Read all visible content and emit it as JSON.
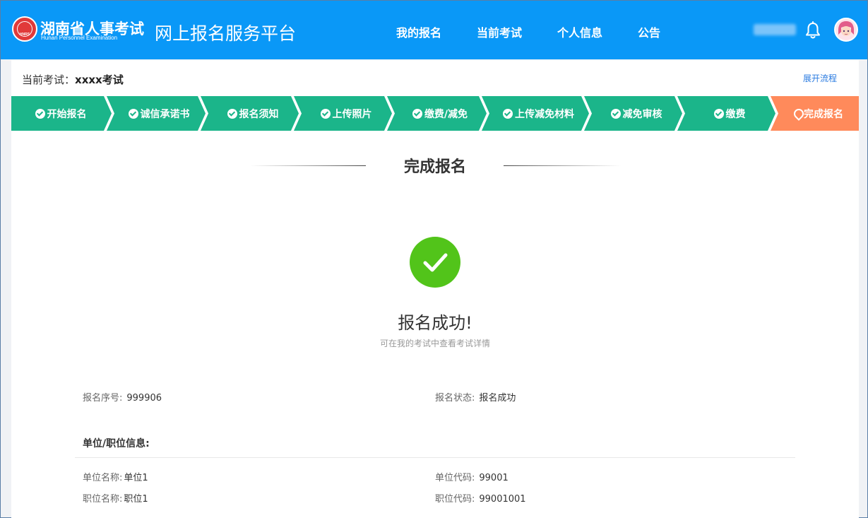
{
  "header": {
    "logo_cn": "湖南省人事考试",
    "logo_en": "Hunan Personnel Examination",
    "logo_badge": "HNRS",
    "platform_title": "网上报名服务平台",
    "nav": [
      "我的报名",
      "当前考试",
      "个人信息",
      "公告"
    ],
    "icons": {
      "bell": "bell-icon",
      "avatar": "avatar"
    }
  },
  "exam": {
    "label": "当前考试：",
    "name": "xxxx考试",
    "expand_link": "展开流程"
  },
  "steps": [
    {
      "label": "开始报名",
      "state": "done"
    },
    {
      "label": "诚信承诺书",
      "state": "done"
    },
    {
      "label": "报名须知",
      "state": "done"
    },
    {
      "label": "上传照片",
      "state": "done"
    },
    {
      "label": "缴费/减免",
      "state": "done"
    },
    {
      "label": "上传减免材料",
      "state": "done"
    },
    {
      "label": "减免审核",
      "state": "done"
    },
    {
      "label": "缴费",
      "state": "done"
    },
    {
      "label": "完成报名",
      "state": "current"
    }
  ],
  "colors": {
    "header_bg": "#0a98f7",
    "step_done": "#1bb58a",
    "step_current": "#ff8a5b",
    "success": "#52c41a"
  },
  "result": {
    "section_title": "完成报名",
    "status_title": "报名成功!",
    "status_sub": "可在我的考试中查看考试详情"
  },
  "details": {
    "serial_label": "报名序号:",
    "serial_value": "999906",
    "status_label": "报名状态:",
    "status_value": "报名成功",
    "unit_section_title": "单位/职位信息:",
    "unit_name_label": "单位名称:",
    "unit_name_value": "单位1",
    "unit_code_label": "单位代码:",
    "unit_code_value": "99001",
    "job_name_label": "职位名称:",
    "job_name_value": "职位1",
    "job_code_label": "职位代码:",
    "job_code_value": "99001001"
  }
}
